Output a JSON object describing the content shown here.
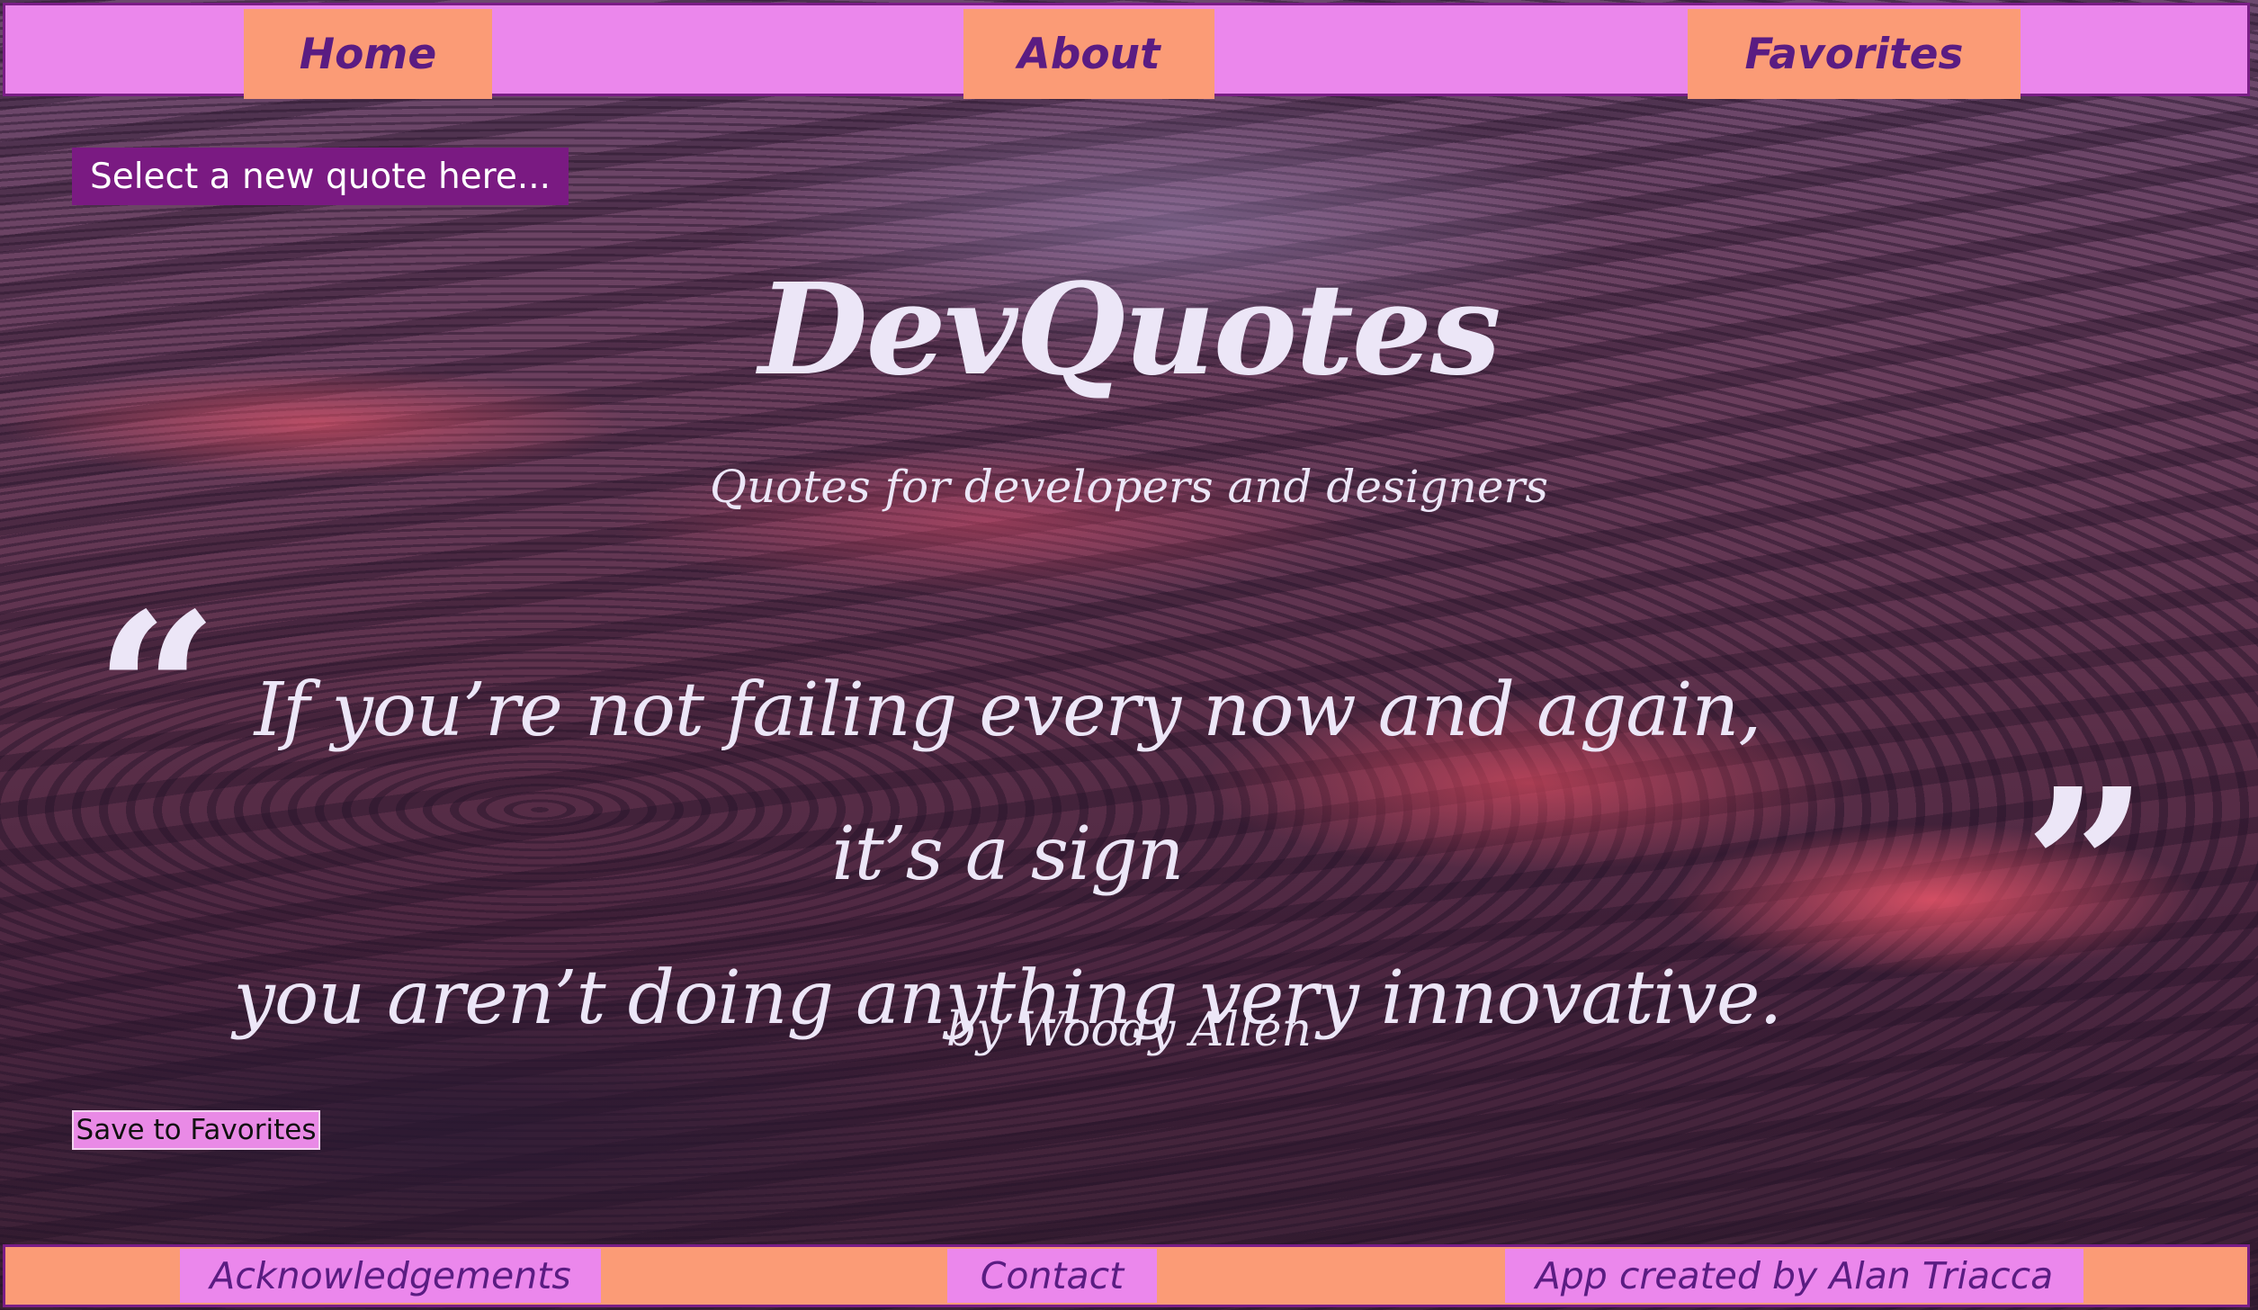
{
  "nav": {
    "home": "Home",
    "about": "About",
    "favorites": "Favorites"
  },
  "controls": {
    "select_quote": "Select a new quote here...",
    "save_favorites": "Save to Favorites"
  },
  "header": {
    "title": "DevQuotes",
    "subtitle": "Quotes for developers and designers"
  },
  "quote": {
    "open_mark": "“",
    "line1": "If you’re not failing every now and again, it’s a sign",
    "line2": "you aren’t doing anything very innovative.",
    "close_mark": "”",
    "author": "by Woody Allen"
  },
  "footer": {
    "acknowledgements": "Acknowledgements",
    "contact": "Contact",
    "credit": "App created by Alan Triacca"
  },
  "colors": {
    "nav_bg": "#eb87ec",
    "tab_bg": "#fb9b76",
    "border": "#7a1d86",
    "nav_text": "#5a1c82",
    "select_bg": "#7a1a82",
    "quote_text": "#ece6f7"
  }
}
